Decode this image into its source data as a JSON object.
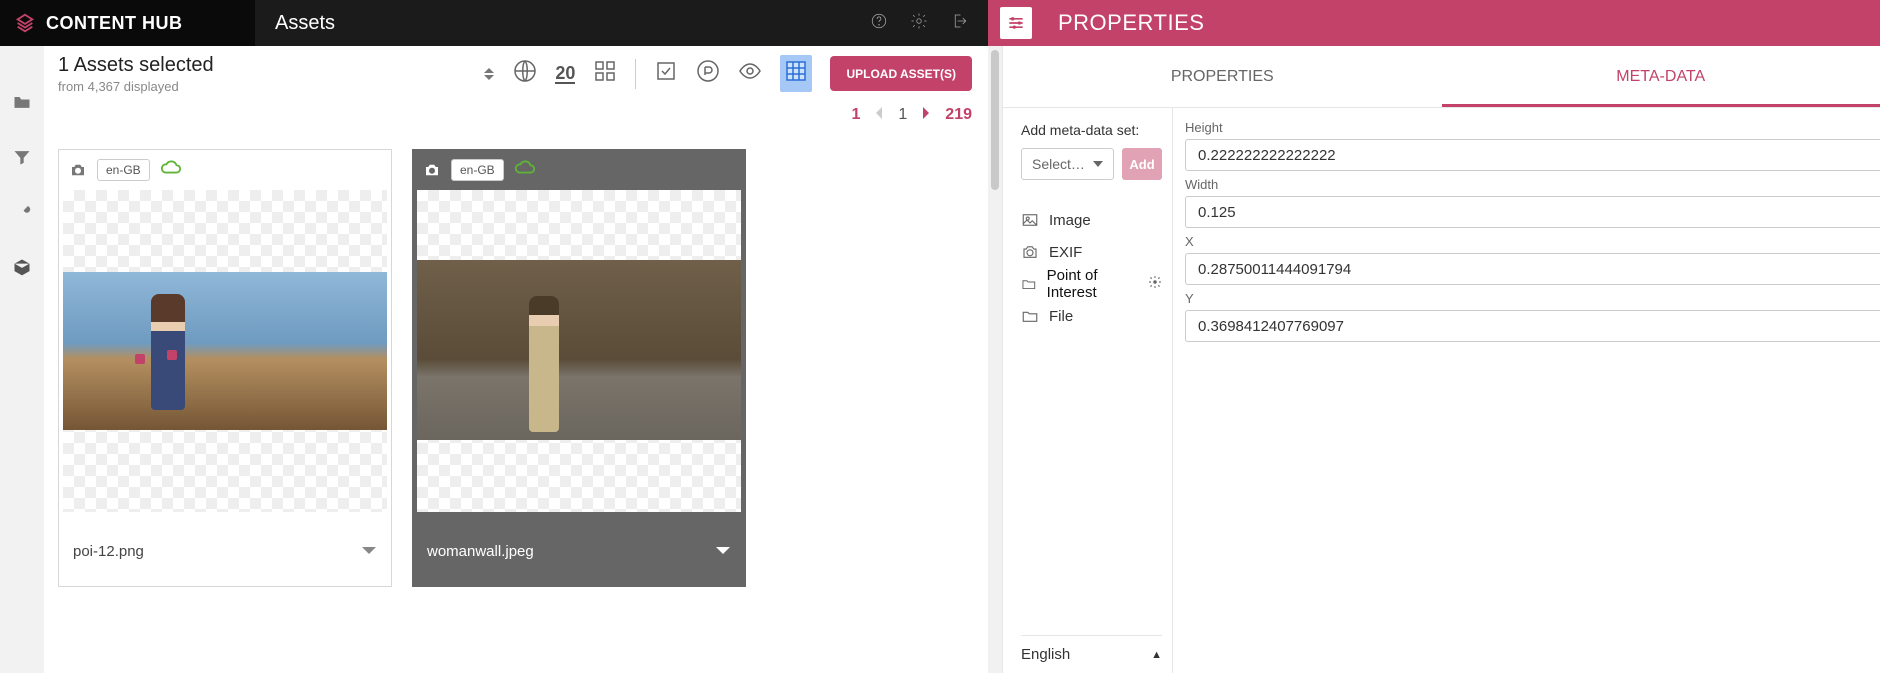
{
  "brand": {
    "name": "CONTENT HUB"
  },
  "page": {
    "title": "Assets"
  },
  "panel": {
    "title": "PROPERTIES",
    "tabs": {
      "props": "PROPERTIES",
      "meta": "META-DATA"
    }
  },
  "selection": {
    "count_line": "1 Assets selected",
    "sub_line": "from 4,367 displayed"
  },
  "toolbar": {
    "page_size": "20",
    "upload": "UPLOAD ASSET(S)"
  },
  "pager": {
    "first": "1",
    "current": "1",
    "last": "219"
  },
  "cards": [
    {
      "locale": "en-GB",
      "filename": "poi-12.png"
    },
    {
      "locale": "en-GB",
      "filename": "womanwall.jpeg"
    }
  ],
  "meta_add": {
    "label": "Add meta-data set:",
    "select_placeholder": "Select…",
    "add_btn": "Add"
  },
  "categories": {
    "image": "Image",
    "exif": "EXIF",
    "poi": "Point of Interest",
    "file": "File"
  },
  "fields": {
    "height": {
      "label": "Height",
      "value": "0.222222222222222"
    },
    "width": {
      "label": "Width",
      "value": "0.125"
    },
    "x": {
      "label": "X",
      "value": "0.28750011444091794"
    },
    "y": {
      "label": "Y",
      "value": "0.3698412407769097"
    }
  },
  "language": {
    "label": "English"
  }
}
